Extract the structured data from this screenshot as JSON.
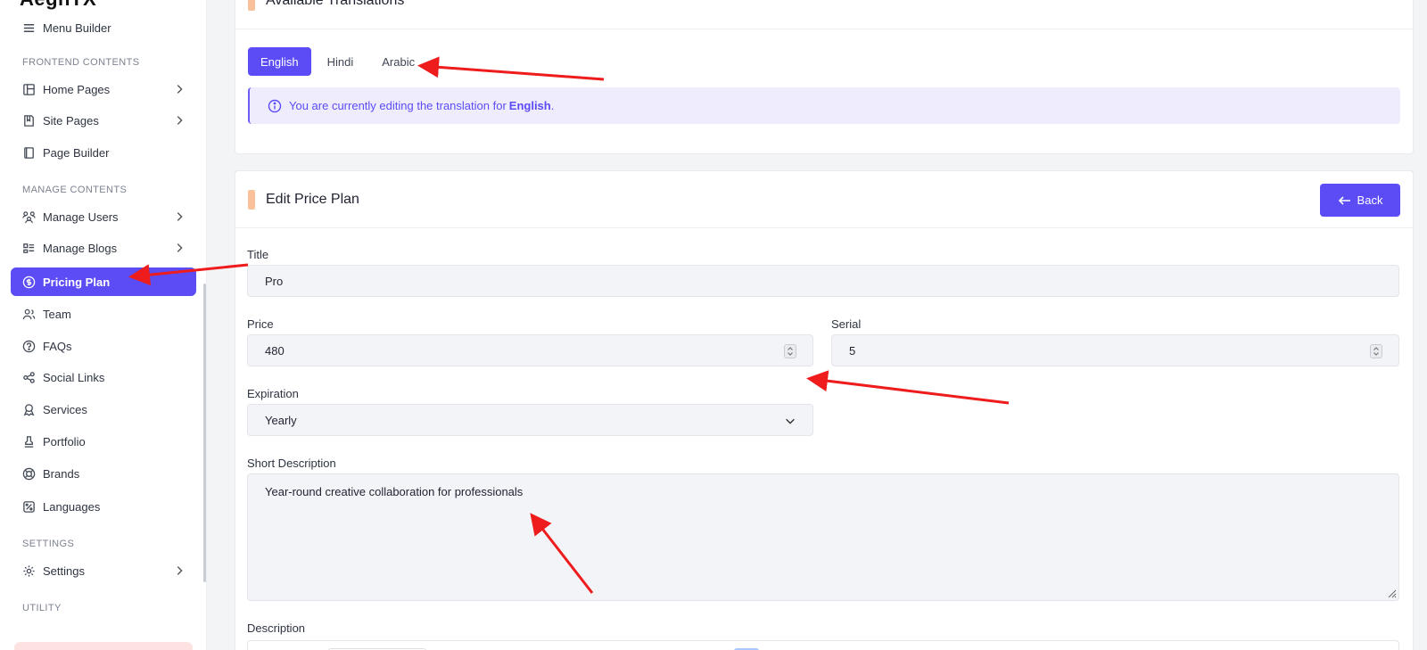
{
  "brand": "AegnTX",
  "sidebar": {
    "top_item": {
      "label": "Menu Builder",
      "icon": "menu-icon"
    },
    "sections": {
      "frontend": "FRONTEND CONTENTS",
      "manage": "MANAGE CONTENTS",
      "settings": "SETTINGS",
      "utility": "UTILITY"
    },
    "items": {
      "home_pages": "Home Pages",
      "site_pages": "Site Pages",
      "page_builder": "Page Builder",
      "manage_users": "Manage Users",
      "manage_blogs": "Manage Blogs",
      "pricing_plan": "Pricing Plan",
      "team": "Team",
      "faqs": "FAQs",
      "social_links": "Social Links",
      "services": "Services",
      "portfolio": "Portfolio",
      "brands": "Brands",
      "languages": "Languages",
      "settings": "Settings"
    },
    "active": "Pricing Plan"
  },
  "translations": {
    "title": "Available Translations",
    "tabs": [
      "English",
      "Hindi",
      "Arabic"
    ],
    "active_tab": "English",
    "info_prefix": "You are currently editing the translation for",
    "info_lang": "English",
    "info_suffix": "."
  },
  "edit": {
    "title": "Edit Price Plan",
    "back_label": "Back",
    "fields": {
      "title_label": "Title",
      "title_value": "Pro",
      "price_label": "Price",
      "price_value": "480",
      "serial_label": "Serial",
      "serial_value": "5",
      "expiration_label": "Expiration",
      "expiration_value": "Yearly",
      "short_desc_label": "Short Description",
      "short_desc_value": "Year-round creative collaboration for professionals",
      "description_label": "Description"
    }
  },
  "colors": {
    "accent": "#5b4cf5",
    "section_bar": "#f9c19a",
    "annotation_arrow": "#ee1c1c"
  }
}
